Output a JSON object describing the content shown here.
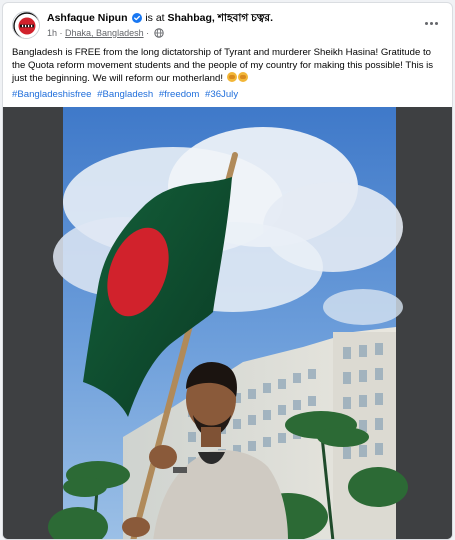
{
  "post": {
    "author": "Ashfaque Nipun",
    "checkin_prefix": "is at",
    "place": "Shahbag, শাহবাগ চত্বর.",
    "time": "1h",
    "location": "Dhaka, Bangladesh",
    "body_text": "Bangladesh is FREE from the long dictatorship of Tyrant and murderer Sheikh Hasina! Gratitude to the Quota reform movement students and the people of my country for making this possible! This is just the beginning. We will reform our motherland!",
    "hashtags": [
      "#Bangladeshisfree",
      "#Bangladesh",
      "#freedom",
      "#36July"
    ]
  },
  "icons": {
    "verified": "verified-badge-icon",
    "globe": "globe-icon",
    "more": "more-options-icon",
    "emoji": "raised-fist-emoji"
  },
  "colors": {
    "link": "#216fdb",
    "verified": "#1877f2",
    "meta": "#65676b",
    "flag_green": "#0e4a2e",
    "flag_red": "#d1222c"
  }
}
